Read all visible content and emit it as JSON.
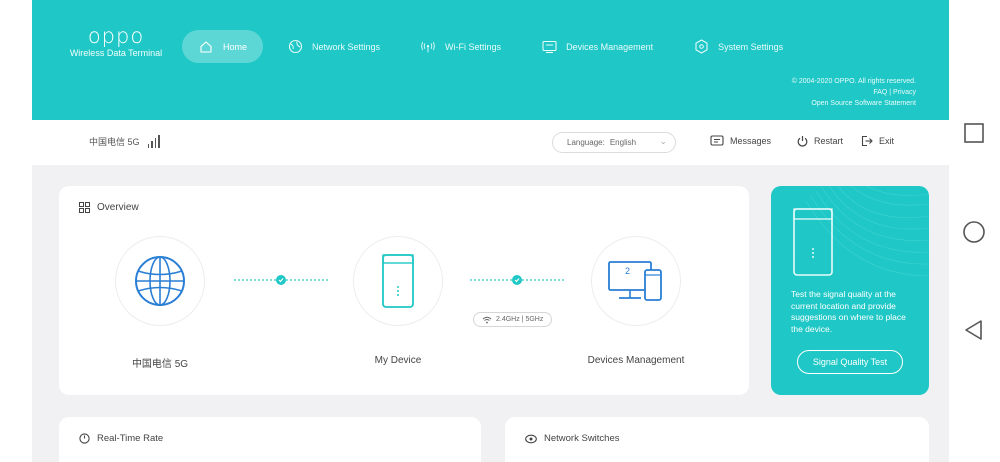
{
  "brand": {
    "logo": "oppo",
    "subtitle": "Wireless Data Terminal"
  },
  "nav": [
    {
      "label": "Home",
      "icon": "home-icon",
      "active": true
    },
    {
      "label": "Network Settings",
      "icon": "globe-icon",
      "active": false
    },
    {
      "label": "Wi-Fi Settings",
      "icon": "wifi-broadcast-icon",
      "active": false
    },
    {
      "label": "Devices Management",
      "icon": "devices-icon",
      "active": false
    },
    {
      "label": "System Settings",
      "icon": "settings-hex-icon",
      "active": false
    }
  ],
  "footer_links": {
    "copyright": "© 2004-2020 OPPO. All rights reserved.",
    "faq_privacy": "FAQ | Privacy",
    "open_source": "Open Source Software Statement"
  },
  "toolbar": {
    "operator": "中国电信 5G",
    "language_label": "Language:",
    "language_value": "English",
    "messages": "Messages",
    "restart": "Restart",
    "exit": "Exit"
  },
  "overview": {
    "title": "Overview",
    "nodes": [
      {
        "label": "中国电信 5G",
        "icon": "globe-icon"
      },
      {
        "label": "My Device",
        "icon": "router-device-icon"
      },
      {
        "label": "Devices Management",
        "icon": "monitor-phone-icon",
        "count": "2"
      }
    ],
    "band": "2.4GHz | 5GHz"
  },
  "signal_card": {
    "text": "Test the signal quality at the current location and provide suggestions on where to place the device.",
    "button": "Signal Quality Test"
  },
  "bottom_cards": {
    "realtime": "Real-Time Rate",
    "switches": "Network Switches"
  },
  "colors": {
    "accent": "#1fc8c6",
    "content_bg": "#f1f1f3"
  }
}
